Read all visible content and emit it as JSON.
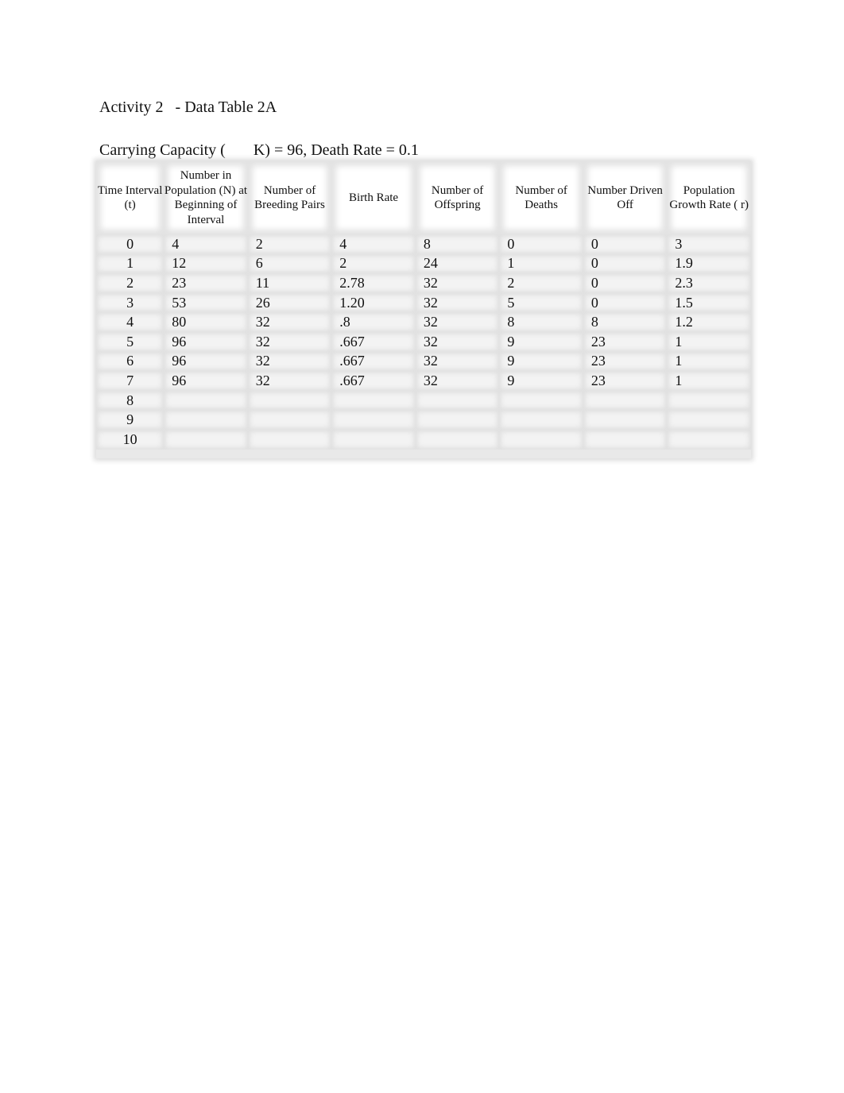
{
  "document": {
    "title": "Activity 2   - Data Table 2A",
    "subtitle": "Carrying Capacity (       K) = 96, Death Rate = 0.1"
  },
  "table": {
    "headers": [
      "Time Interval (t)",
      "Number in Population (N) at Beginning of Interval",
      "Number of Breeding Pairs",
      "Birth Rate",
      "Number of Offspring",
      "Number of Deaths",
      "Number Driven Off",
      "Population Growth Rate (  r)"
    ],
    "rows": [
      [
        "0",
        "4",
        "2",
        "4",
        "8",
        "0",
        "0",
        "3"
      ],
      [
        "1",
        "12",
        "6",
        "2",
        "24",
        "1",
        "0",
        "1.9"
      ],
      [
        "2",
        "23",
        "11",
        "2.78",
        "32",
        "2",
        "0",
        "2.3"
      ],
      [
        "3",
        "53",
        "26",
        "1.20",
        "32",
        "5",
        "0",
        "1.5"
      ],
      [
        "4",
        "80",
        "32",
        ".8",
        "32",
        "8",
        "8",
        "1.2"
      ],
      [
        "5",
        "96",
        "32",
        ".667",
        "32",
        "9",
        "23",
        "1"
      ],
      [
        "6",
        "96",
        "32",
        ".667",
        "32",
        "9",
        "23",
        "1"
      ],
      [
        "7",
        "96",
        "32",
        ".667",
        "32",
        "9",
        "23",
        "1"
      ],
      [
        "8",
        "",
        "",
        "",
        "",
        "",
        "",
        ""
      ],
      [
        "9",
        "",
        "",
        "",
        "",
        "",
        "",
        ""
      ],
      [
        "10",
        "",
        "",
        "",
        "",
        "",
        "",
        ""
      ]
    ]
  }
}
